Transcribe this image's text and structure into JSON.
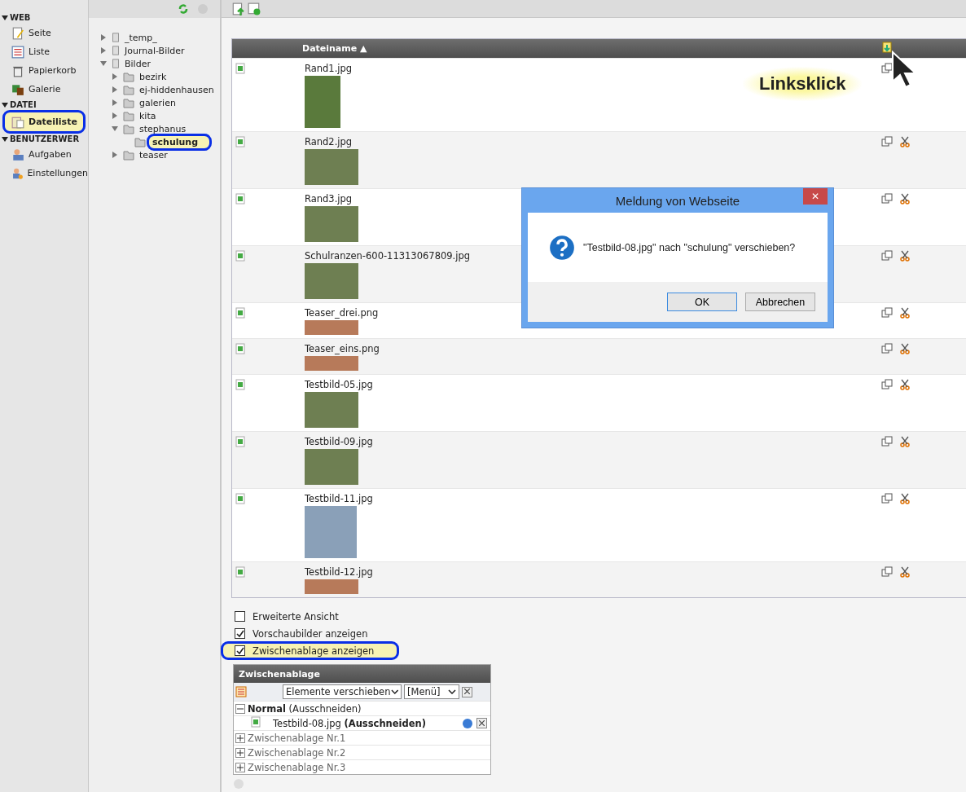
{
  "modules": [
    {
      "title": "WEB",
      "items": [
        {
          "label": "Seite",
          "kind": "page",
          "selected": false,
          "highlighted": false
        },
        {
          "label": "Liste",
          "kind": "list",
          "selected": false,
          "highlighted": false
        },
        {
          "label": "Papierkorb",
          "kind": "trash",
          "selected": false,
          "highlighted": false
        },
        {
          "label": "Galerie",
          "kind": "gallery",
          "selected": false,
          "highlighted": false
        }
      ]
    },
    {
      "title": "DATEI",
      "items": [
        {
          "label": "Dateiliste",
          "kind": "filelist",
          "selected": true,
          "highlighted": true
        }
      ]
    },
    {
      "title": "BENUTZERWER",
      "items": [
        {
          "label": "Aufgaben",
          "kind": "tasks",
          "selected": false,
          "highlighted": false
        },
        {
          "label": "Einstellungen",
          "kind": "settings",
          "selected": false,
          "highlighted": false
        }
      ]
    }
  ],
  "tree": [
    {
      "label": "_temp_",
      "kind": "mount",
      "expanded": false,
      "selected": false,
      "highlighted": false
    },
    {
      "label": "Journal-Bilder",
      "kind": "mount",
      "expanded": false,
      "selected": false,
      "highlighted": false
    },
    {
      "label": "Bilder",
      "kind": "mount",
      "expanded": true,
      "selected": false,
      "highlighted": false,
      "children": [
        {
          "label": "bezirk",
          "kind": "folder",
          "expanded": false,
          "selected": false,
          "highlighted": false
        },
        {
          "label": "ej-hiddenhausen",
          "kind": "folder",
          "expanded": false,
          "selected": false,
          "highlighted": false
        },
        {
          "label": "galerien",
          "kind": "folder",
          "expanded": false,
          "selected": false,
          "highlighted": false
        },
        {
          "label": "kita",
          "kind": "folder",
          "expanded": false,
          "selected": false,
          "highlighted": false
        },
        {
          "label": "stephanus",
          "kind": "folder",
          "expanded": true,
          "selected": false,
          "highlighted": false,
          "children": [
            {
              "label": "schulung",
              "kind": "folder",
              "expanded": false,
              "selected": true,
              "highlighted": true
            }
          ]
        },
        {
          "label": "teaser",
          "kind": "folder",
          "expanded": false,
          "selected": false,
          "highlighted": false
        }
      ]
    }
  ],
  "file_table": {
    "column": "Dateiname",
    "sort_arrow": "▲",
    "rows": [
      {
        "name": "Rand1.jpg",
        "kind": "tall",
        "cut_icon": false
      },
      {
        "name": "Rand2.jpg",
        "kind": "wide",
        "cut_icon": true
      },
      {
        "name": "Rand3.jpg",
        "kind": "wide",
        "cut_icon": true
      },
      {
        "name": "Schulranzen-600-11313067809.jpg",
        "kind": "wide",
        "cut_icon": true
      },
      {
        "name": "Teaser_drei.png",
        "kind": "banner",
        "cut_icon": true
      },
      {
        "name": "Teaser_eins.png",
        "kind": "banner",
        "cut_icon": true
      },
      {
        "name": "Testbild-05.jpg",
        "kind": "wide",
        "cut_icon": true
      },
      {
        "name": "Testbild-09.jpg",
        "kind": "wide",
        "cut_icon": true
      },
      {
        "name": "Testbild-11.jpg",
        "kind": "square",
        "cut_icon": true
      },
      {
        "name": "Testbild-12.jpg",
        "kind": "banner",
        "cut_icon": true
      }
    ]
  },
  "callout": "Linksklick",
  "options": [
    {
      "label": "Erweiterte Ansicht",
      "checked": false,
      "highlighted": false
    },
    {
      "label": "Vorschaubilder anzeigen",
      "checked": true,
      "highlighted": false
    },
    {
      "label": "Zwischenablage anzeigen",
      "checked": true,
      "highlighted": true
    }
  ],
  "clipboard": {
    "title": "Zwischenablage",
    "action_select": "Elemente verschieben",
    "menu_select": "[Menü]",
    "groups": [
      {
        "name": "Normal",
        "mode": "(Ausschneiden)",
        "expanded": true,
        "items": [
          {
            "file": "Testbild-08.jpg",
            "mode": "(Ausschneiden)"
          }
        ]
      },
      {
        "name": "Zwischenablage Nr.1",
        "expanded": false
      },
      {
        "name": "Zwischenablage Nr.2",
        "expanded": false
      },
      {
        "name": "Zwischenablage Nr.3",
        "expanded": false
      }
    ]
  },
  "dialog": {
    "title": "Meldung von Webseite",
    "close": "✕",
    "message": "\"Testbild-08.jpg\" nach \"schulung\" verschieben?",
    "buttons": [
      "OK",
      "Abbrechen"
    ]
  }
}
